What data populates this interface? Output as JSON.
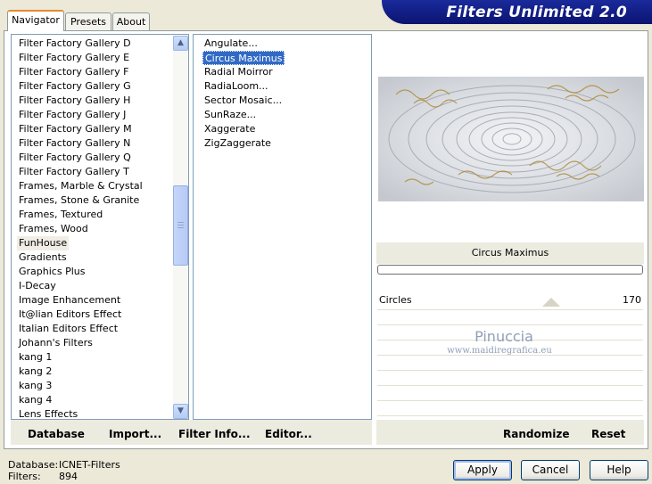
{
  "tabs": [
    {
      "label": "Navigator"
    },
    {
      "label": "Presets"
    },
    {
      "label": "About"
    }
  ],
  "banner": {
    "title": "Filters Unlimited 2.0"
  },
  "categories": [
    "Filter Factory Gallery D",
    "Filter Factory Gallery E",
    "Filter Factory Gallery F",
    "Filter Factory Gallery G",
    "Filter Factory Gallery H",
    "Filter Factory Gallery J",
    "Filter Factory Gallery M",
    "Filter Factory Gallery N",
    "Filter Factory Gallery Q",
    "Filter Factory Gallery T",
    "Frames, Marble & Crystal",
    "Frames, Stone & Granite",
    "Frames, Textured",
    "Frames, Wood",
    "FunHouse",
    "Gradients",
    "Graphics Plus",
    "I-Decay",
    "Image Enhancement",
    "It@lian Editors Effect",
    "Italian Editors Effect",
    "Johann's Filters",
    "kang 1",
    "kang 2",
    "kang 3",
    "kang 4",
    "Lens Effects"
  ],
  "filters": [
    "Angulate...",
    "Circus Maximus",
    "Radial Moirror",
    "RadiaLoom...",
    "Sector Mosaic...",
    "SunRaze...",
    "Xaggerate",
    "ZigZaggerate"
  ],
  "preview": {
    "filter_name": "Circus Maximus"
  },
  "parameter": {
    "label": "Circles",
    "value": "170"
  },
  "watermark": {
    "line1": "Pinuccia",
    "line2": "www.maidiregrafica.eu"
  },
  "bottom_bar": {
    "database_label": "Database",
    "import_label": "Import...",
    "filter_info_label": "Filter Info...",
    "editor_label": "Editor...",
    "randomize_label": "Randomize",
    "reset_label": "Reset"
  },
  "status": {
    "database_key": "Database:",
    "database_value": "ICNET-Filters",
    "filters_key": "Filters:",
    "filters_value": "894"
  },
  "buttons": {
    "apply": "Apply",
    "cancel": "Cancel",
    "help": "Help"
  },
  "selected": {
    "category_index": 14,
    "filter_index": 1
  },
  "colors": {
    "banner": "#0b1470",
    "selection": "#316ac5",
    "tab_accent": "#e68b2c"
  }
}
